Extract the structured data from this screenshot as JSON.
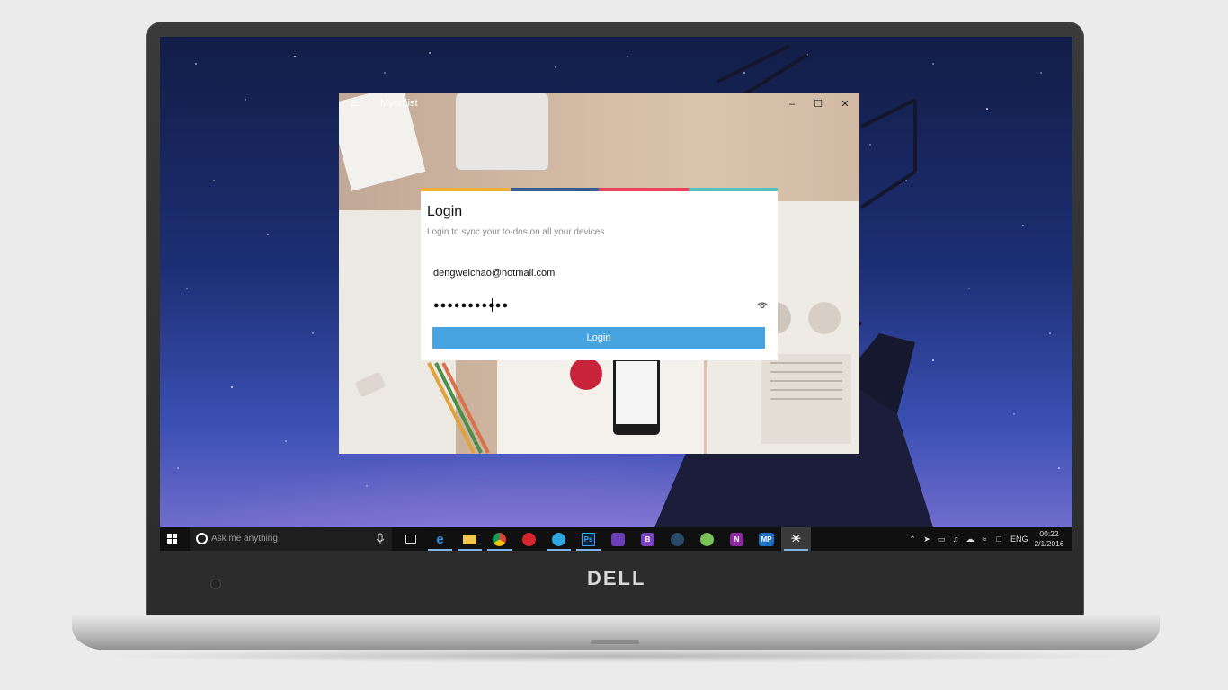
{
  "device": {
    "brand": "DELL"
  },
  "app": {
    "title": "MyerList",
    "back_icon": "back-arrow-icon",
    "window_controls": {
      "minimize": "–",
      "maximize": "☐",
      "close": "✕"
    }
  },
  "login": {
    "title": "Login",
    "subtitle": "Login to sync your to-dos on all your devices",
    "email_value": "dengweichao@hotmail.com",
    "password_value": "●●●●●●●●●●●",
    "button_label": "Login",
    "stripe_colors": [
      "#f4b03f",
      "#365c92",
      "#e8435a",
      "#54c2b9"
    ],
    "accent": "#47a4e0"
  },
  "taskbar": {
    "search_placeholder": "Ask me anything",
    "apps": [
      {
        "name": "task-view",
        "label": ""
      },
      {
        "name": "edge",
        "label": "e"
      },
      {
        "name": "file-explorer",
        "label": ""
      },
      {
        "name": "chrome",
        "label": ""
      },
      {
        "name": "netease-music",
        "label": ""
      },
      {
        "name": "telegram",
        "label": ""
      },
      {
        "name": "photoshop",
        "label": "Ps"
      },
      {
        "name": "visual-studio",
        "label": ""
      },
      {
        "name": "visual-studio-blend",
        "label": "B"
      },
      {
        "name": "steam",
        "label": ""
      },
      {
        "name": "android-studio",
        "label": ""
      },
      {
        "name": "onenote",
        "label": "N"
      },
      {
        "name": "mp-app",
        "label": "MP"
      },
      {
        "name": "myerlist",
        "label": ""
      }
    ],
    "language": "ENG",
    "time": "00:22",
    "date": "2/1/2016"
  }
}
